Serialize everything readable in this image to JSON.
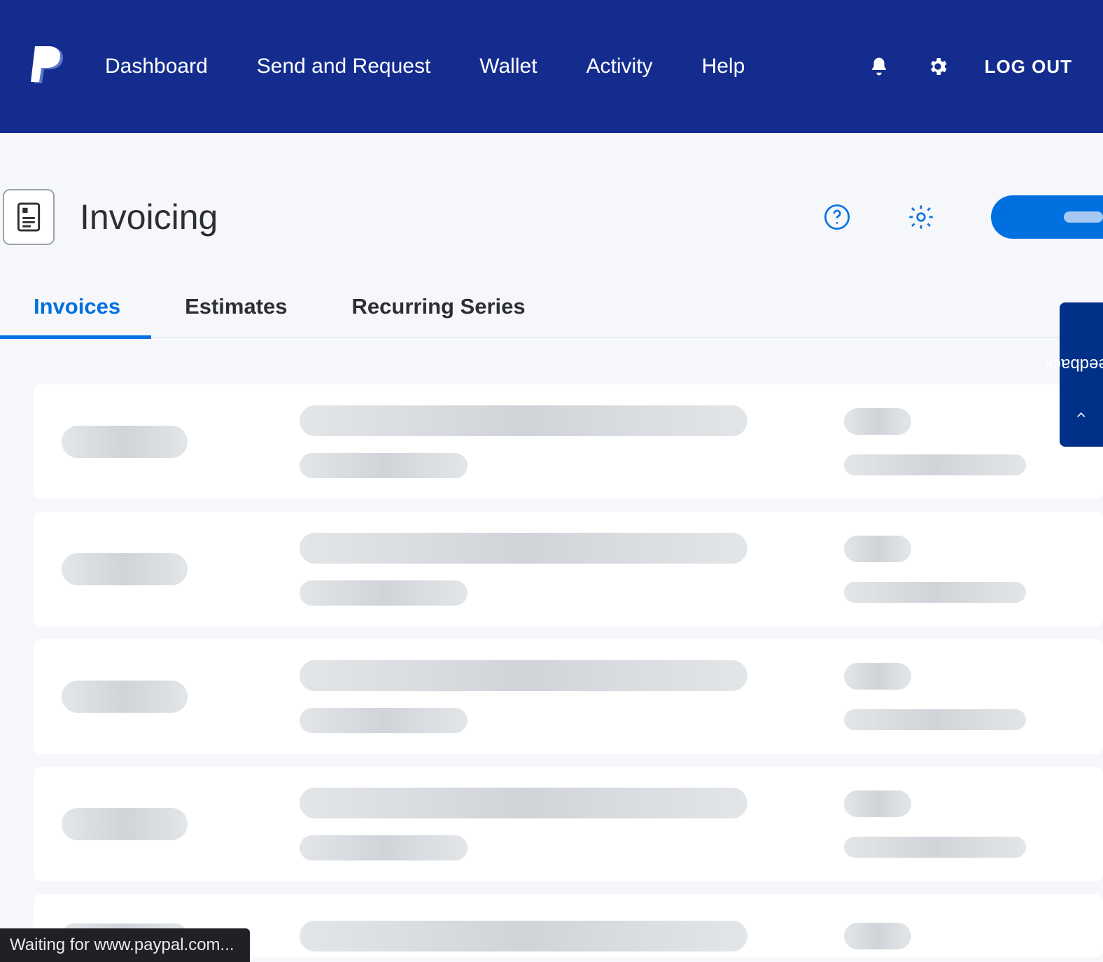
{
  "nav": {
    "items": [
      "Dashboard",
      "Send and Request",
      "Wallet",
      "Activity",
      "Help"
    ],
    "logout": "LOG OUT"
  },
  "page": {
    "title": "Invoicing"
  },
  "tabs": {
    "items": [
      "Invoices",
      "Estimates",
      "Recurring Series"
    ],
    "active_index": 0
  },
  "feedback": {
    "label": "Feedback"
  },
  "status": {
    "text": "Waiting for www.paypal.com..."
  }
}
